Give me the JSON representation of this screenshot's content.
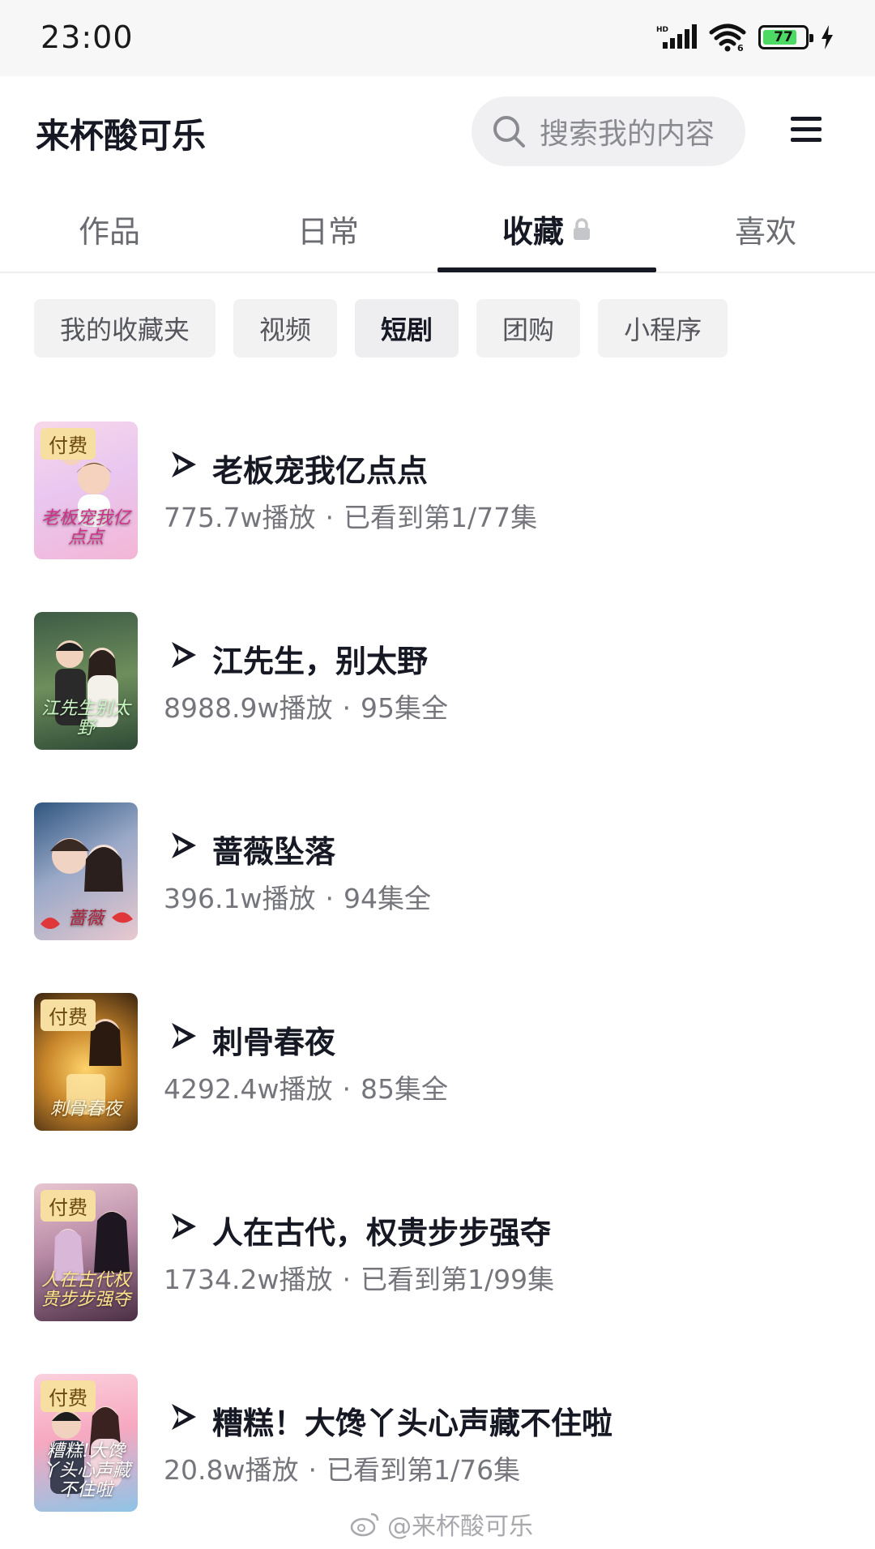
{
  "status_bar": {
    "time": "23:00",
    "battery": "77"
  },
  "header": {
    "profile_name": "来杯酸可乐",
    "search_placeholder": "搜索我的内容"
  },
  "tabs": [
    {
      "label": "作品"
    },
    {
      "label": "日常"
    },
    {
      "label": "收藏",
      "active": true
    },
    {
      "label": "喜欢"
    }
  ],
  "chips": [
    {
      "label": "我的收藏夹"
    },
    {
      "label": "视频"
    },
    {
      "label": "短剧",
      "active": true
    },
    {
      "label": "团购"
    },
    {
      "label": "小程序"
    }
  ],
  "items": [
    {
      "title": "老板宠我亿点点",
      "plays": "775.7w播放",
      "progress": "已看到第1/77集",
      "paid": "付费",
      "cover_text": "老板宠我亿点点"
    },
    {
      "title": "江先生，别太野",
      "plays": "8988.9w播放",
      "progress": "95集全",
      "paid": "",
      "cover_text": "江先生别太野"
    },
    {
      "title": "蔷薇坠落",
      "plays": "396.1w播放",
      "progress": "94集全",
      "paid": "",
      "cover_text": "蔷薇"
    },
    {
      "title": "刺骨春夜",
      "plays": "4292.4w播放",
      "progress": "85集全",
      "paid": "付费",
      "cover_text": "刺骨春夜"
    },
    {
      "title": "人在古代，权贵步步强夺",
      "plays": "1734.2w播放",
      "progress": "已看到第1/99集",
      "paid": "付费",
      "cover_text": "人在古代权贵步步强夺"
    },
    {
      "title": "糟糕！大馋丫头心声藏不住啦",
      "plays": "20.8w播放",
      "progress": "已看到第1/76集",
      "paid": "付费",
      "cover_text": "糟糕!大馋丫头心声藏不住啦"
    }
  ],
  "separator": "·",
  "watermark": "@来杯酸可乐"
}
